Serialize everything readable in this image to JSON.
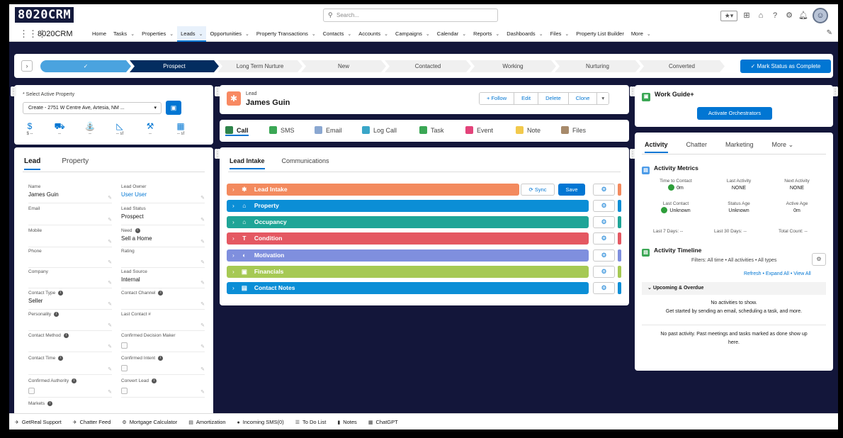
{
  "header": {
    "logo": "8020CRM",
    "search_placeholder": "Search..."
  },
  "nav": {
    "app_name": "8020CRM",
    "items": [
      {
        "label": "Home",
        "chevron": false
      },
      {
        "label": "Tasks",
        "chevron": true
      },
      {
        "label": "Properties",
        "chevron": true
      },
      {
        "label": "Leads",
        "chevron": true,
        "active": true
      },
      {
        "label": "Opportunities",
        "chevron": true
      },
      {
        "label": "Property Transactions",
        "chevron": true
      },
      {
        "label": "Contacts",
        "chevron": true
      },
      {
        "label": "Accounts",
        "chevron": true
      },
      {
        "label": "Campaigns",
        "chevron": true
      },
      {
        "label": "Calendar",
        "chevron": true
      },
      {
        "label": "Reports",
        "chevron": true
      },
      {
        "label": "Dashboards",
        "chevron": true
      },
      {
        "label": "Files",
        "chevron": true
      },
      {
        "label": "Property List Builder",
        "chevron": false
      },
      {
        "label": "More",
        "chevron": true
      }
    ]
  },
  "path": {
    "stages": [
      "✓",
      "Prospect",
      "Long Term Nurture",
      "New",
      "Contacted",
      "Working",
      "Nurturing",
      "Converted"
    ],
    "mark_button": "✓ Mark Status as Complete"
  },
  "property": {
    "label": "* Select Active Property",
    "selected": "Create - 2751 W Centre Ave, Artesia, NM ...",
    "icons": [
      {
        "icon": "dollar-icon",
        "glyph": "$",
        "value": "$ --"
      },
      {
        "icon": "car-icon",
        "glyph": "⛟",
        "value": "--"
      },
      {
        "icon": "bath-icon",
        "glyph": "⛲",
        "value": "--"
      },
      {
        "icon": "triangle-ruler-icon",
        "glyph": "◺",
        "value": "-- sf"
      },
      {
        "icon": "hammer-icon",
        "glyph": "⚒",
        "value": "--"
      },
      {
        "icon": "map-icon",
        "glyph": "▦",
        "value": "-- sf"
      }
    ]
  },
  "lead_tabs": [
    "Lead",
    "Property"
  ],
  "fields": [
    {
      "label": "Name",
      "value": "James Guin",
      "col": 0,
      "row": 0
    },
    {
      "label": "Lead Owner",
      "value": "User User",
      "col": 1,
      "row": 0,
      "link": true
    },
    {
      "label": "Email",
      "value": "",
      "col": 0,
      "row": 1
    },
    {
      "label": "Lead Status",
      "value": "Prospect",
      "col": 1,
      "row": 1
    },
    {
      "label": "Mobile",
      "value": "",
      "col": 0,
      "row": 2
    },
    {
      "label": "Need",
      "value": "Sell a Home",
      "col": 1,
      "row": 2,
      "info": true
    },
    {
      "label": "Phone",
      "value": "",
      "col": 0,
      "row": 3
    },
    {
      "label": "Rating",
      "value": "",
      "col": 1,
      "row": 3
    },
    {
      "label": "Company",
      "value": "",
      "col": 0,
      "row": 4
    },
    {
      "label": "Lead Source",
      "value": "Internal",
      "col": 1,
      "row": 4
    },
    {
      "label": "Contact Type",
      "value": "Seller",
      "col": 0,
      "row": 5,
      "info": true
    },
    {
      "label": "Contact Channel",
      "value": "",
      "col": 1,
      "row": 5,
      "info": true
    },
    {
      "label": "Personality",
      "value": "",
      "col": 0,
      "row": 6,
      "info": true
    },
    {
      "label": "Last Contact #",
      "value": "",
      "col": 1,
      "row": 6
    },
    {
      "label": "Contact Method",
      "value": "",
      "col": 0,
      "row": 7,
      "info": true
    },
    {
      "label": "Confirmed Decision Maker",
      "value": "",
      "col": 1,
      "row": 7,
      "checkbox": true
    },
    {
      "label": "Contact Time",
      "value": "",
      "col": 0,
      "row": 8,
      "info": true
    },
    {
      "label": "Confirmed Intent",
      "value": "",
      "col": 1,
      "row": 8,
      "info": true,
      "checkbox": true
    },
    {
      "label": "Confirmed Authority",
      "value": "",
      "col": 0,
      "row": 9,
      "info": true,
      "checkbox": true
    },
    {
      "label": "Convert Lead",
      "value": "",
      "col": 1,
      "row": 9,
      "info": true,
      "checkbox": true
    },
    {
      "label": "Markets",
      "value": "",
      "col": 0,
      "row": 10,
      "info": true
    }
  ],
  "lead_header": {
    "object_label": "Lead",
    "name": "James Guin",
    "buttons": [
      "+ Follow",
      "Edit",
      "Delete",
      "Clone"
    ]
  },
  "activity_buttons": [
    {
      "label": "Call",
      "color": "#2e844a",
      "active": true
    },
    {
      "label": "SMS",
      "color": "#3ba755"
    },
    {
      "label": "Email",
      "color": "#8aa7d1"
    },
    {
      "label": "Log Call",
      "color": "#3aa6c8"
    },
    {
      "label": "Task",
      "color": "#3ba755"
    },
    {
      "label": "Event",
      "color": "#e3437a"
    },
    {
      "label": "Note",
      "color": "#f2c94c"
    },
    {
      "label": "Files",
      "color": "#a78a6b"
    }
  ],
  "section_tabs": [
    "Lead Intake",
    "Communications"
  ],
  "sections": [
    {
      "label": "Lead Intake",
      "color": "#f38a5e",
      "bar": "#f38a5e",
      "icon": "person-icon",
      "glyph": "✱"
    },
    {
      "label": "Property",
      "color": "#0b8ed6",
      "bar": "#0b8ed6",
      "icon": "home-icon",
      "glyph": "⌂"
    },
    {
      "label": "Occupancy",
      "color": "#1fa597",
      "bar": "#1fa597",
      "icon": "building-icon",
      "glyph": "⌂"
    },
    {
      "label": "Condition",
      "color": "#e45862",
      "bar": "#e45862",
      "icon": "hammer-icon",
      "glyph": "T"
    },
    {
      "label": "Motivation",
      "color": "#7f8fde",
      "bar": "#7f8fde",
      "icon": "brain-icon",
      "glyph": "◐"
    },
    {
      "label": "Financials",
      "color": "#a6c954",
      "bar": "#a6c954",
      "icon": "bank-icon",
      "glyph": "▣"
    },
    {
      "label": "Contact Notes",
      "color": "#0b8ed6",
      "bar": "#0b8ed6",
      "icon": "card-icon",
      "glyph": "▤"
    }
  ],
  "section_actions": {
    "sync": "⟳ Sync",
    "save": "Save"
  },
  "work_guide": {
    "title": "Work Guide+",
    "button": "Activate Orchestrators"
  },
  "activity": {
    "tabs": [
      "Activity",
      "Chatter",
      "Marketing",
      "More"
    ],
    "metrics_title": "Activity Metrics",
    "metrics": [
      {
        "label": "Time to Contact",
        "value": "0m",
        "dot": true
      },
      {
        "label": "Last Activity",
        "value": "NONE"
      },
      {
        "label": "Next Activity",
        "value": "NONE"
      },
      {
        "label": "Last Contact",
        "value": "Unknown",
        "dot": true
      },
      {
        "label": "Status Age",
        "value": "Unknown"
      },
      {
        "label": "Active Age",
        "value": "0m"
      }
    ],
    "counts": [
      "Last 7 Days: --",
      "Last 30 Days: --",
      "Total Count: --"
    ],
    "timeline_title": "Activity Timeline",
    "filters": "Filters: All time • All activities • All types",
    "links": "Refresh • Expand All • View All",
    "upcoming": "Upcoming & Overdue",
    "no_activities": "No activities to show.",
    "get_started": "Get started by sending an email, scheduling a task, and more.",
    "no_past_1": "No past activity. Past meetings and tasks marked as done show up",
    "no_past_2": "here."
  },
  "utility_bar": [
    {
      "label": "GetReal Support",
      "icon": "rocket-icon",
      "glyph": "✈"
    },
    {
      "label": "Chatter Feed",
      "icon": "chatter-icon",
      "glyph": "✈"
    },
    {
      "label": "Mortgage Calculator",
      "icon": "calculator-icon",
      "glyph": "⚙"
    },
    {
      "label": "Amortization",
      "icon": "table-icon",
      "glyph": "▤"
    },
    {
      "label": "Incoming SMS(0)",
      "icon": "message-icon",
      "glyph": "●"
    },
    {
      "label": "To Do List",
      "icon": "checklist-icon",
      "glyph": "☰"
    },
    {
      "label": "Notes",
      "icon": "note-icon",
      "glyph": "▮"
    },
    {
      "label": "ChatGPT",
      "icon": "chat-icon",
      "glyph": "▦"
    }
  ]
}
